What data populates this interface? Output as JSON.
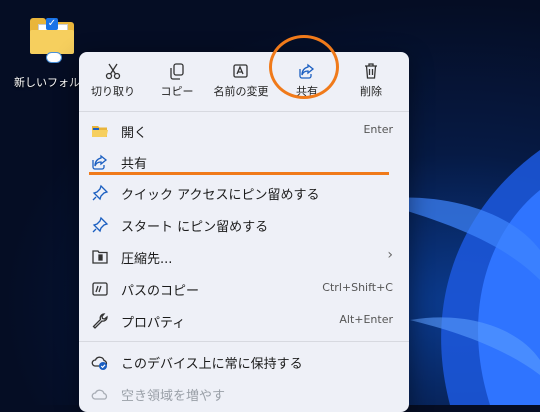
{
  "desktop": {
    "icon_label": "新しいフォルダ",
    "wave_color": "#2a6df5"
  },
  "toolbar": {
    "cut": "切り取り",
    "copy": "コピー",
    "rename": "名前の変更",
    "share": "共有",
    "delete": "削除"
  },
  "menu": {
    "items": [
      {
        "label": "開く",
        "accel": "Enter",
        "icon": "folder-open-icon"
      },
      {
        "label": "共有",
        "accel": "",
        "icon": "share-icon"
      },
      {
        "label": "クイック アクセスにピン留めする",
        "accel": "",
        "icon": "pin-icon"
      },
      {
        "label": "スタート にピン留めする",
        "accel": "",
        "icon": "pin-icon"
      },
      {
        "label": "圧縮先...",
        "accel": "",
        "icon": "zip-icon",
        "submenu": true
      },
      {
        "label": "パスのコピー",
        "accel": "Ctrl+Shift+C",
        "icon": "path-icon"
      },
      {
        "label": "プロパティ",
        "accel": "Alt+Enter",
        "icon": "wrench-icon"
      },
      {
        "label": "このデバイス上に常に保持する",
        "accel": "",
        "icon": "cloud-keep-icon"
      },
      {
        "label": "空き領域を増やす",
        "accel": "",
        "icon": "cloud-icon"
      }
    ]
  },
  "annotation_color": "#f07a1a"
}
